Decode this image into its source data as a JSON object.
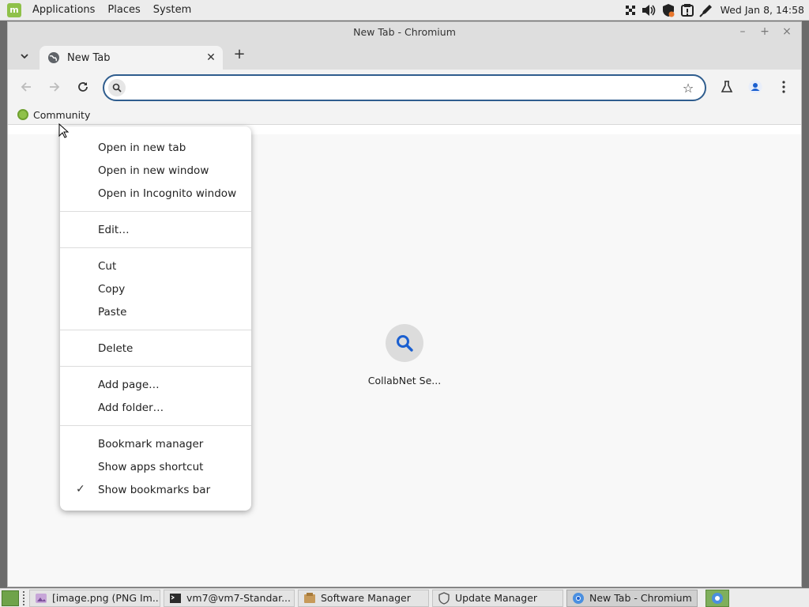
{
  "top_panel": {
    "menus": [
      "Applications",
      "Places",
      "System"
    ],
    "clock": "Wed Jan  8, 14:58"
  },
  "window": {
    "title": "New Tab - Chromium",
    "controls": {
      "minimize": "–",
      "maximize": "+",
      "close": "×"
    }
  },
  "tabs": [
    {
      "title": "New Tab",
      "active": true
    }
  ],
  "toolbar": {
    "omnibox_value": "",
    "omnibox_placeholder": ""
  },
  "bookmarks_bar": {
    "items": [
      {
        "label": "Community"
      }
    ]
  },
  "new_tab_page": {
    "shortcuts": [
      {
        "label": "CollabNet Se..."
      }
    ]
  },
  "context_menu": {
    "groups": [
      [
        "Open in new tab",
        "Open in new window",
        "Open in Incognito window"
      ],
      [
        "Edit…"
      ],
      [
        "Cut",
        "Copy",
        "Paste"
      ],
      [
        "Delete"
      ],
      [
        "Add page…",
        "Add folder…"
      ],
      [
        "Bookmark manager",
        "Show apps shortcut",
        "Show bookmarks bar"
      ]
    ],
    "checked_item": "Show bookmarks bar"
  },
  "taskbar": {
    "tasks": [
      {
        "label": "[image.png (PNG Im...",
        "icon": "image-viewer-icon"
      },
      {
        "label": "vm7@vm7-Standar...",
        "icon": "terminal-icon"
      },
      {
        "label": "Software Manager",
        "icon": "software-manager-icon"
      },
      {
        "label": "Update Manager",
        "icon": "shield-icon"
      },
      {
        "label": "New Tab - Chromium",
        "icon": "chromium-icon",
        "active": true
      }
    ]
  },
  "colors": {
    "accent": "#2f5d8e",
    "mint_green": "#8fc149",
    "search_blue": "#1a5fd0"
  }
}
